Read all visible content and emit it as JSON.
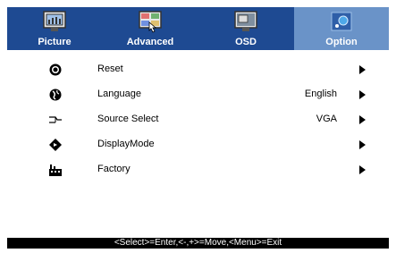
{
  "tabs": [
    {
      "label": "Picture",
      "icon": "picture-icon"
    },
    {
      "label": "Advanced",
      "icon": "advanced-icon"
    },
    {
      "label": "OSD",
      "icon": "osd-icon"
    },
    {
      "label": "Option",
      "icon": "option-icon",
      "active": true
    }
  ],
  "menu": [
    {
      "label": "Reset",
      "value": "",
      "icon": "reset-icon"
    },
    {
      "label": "Language",
      "value": "English",
      "icon": "globe-icon"
    },
    {
      "label": "Source Select",
      "value": "VGA",
      "icon": "source-icon"
    },
    {
      "label": "DisplayMode",
      "value": "",
      "icon": "display-mode-icon"
    },
    {
      "label": "Factory",
      "value": "",
      "icon": "factory-icon"
    }
  ],
  "status": "<Select>=Enter,<-,+>=Move,<Menu>=Exit",
  "colors": {
    "bar": "#1e4a92",
    "active_tab": "#6a93c8",
    "status_bg": "#000000"
  }
}
